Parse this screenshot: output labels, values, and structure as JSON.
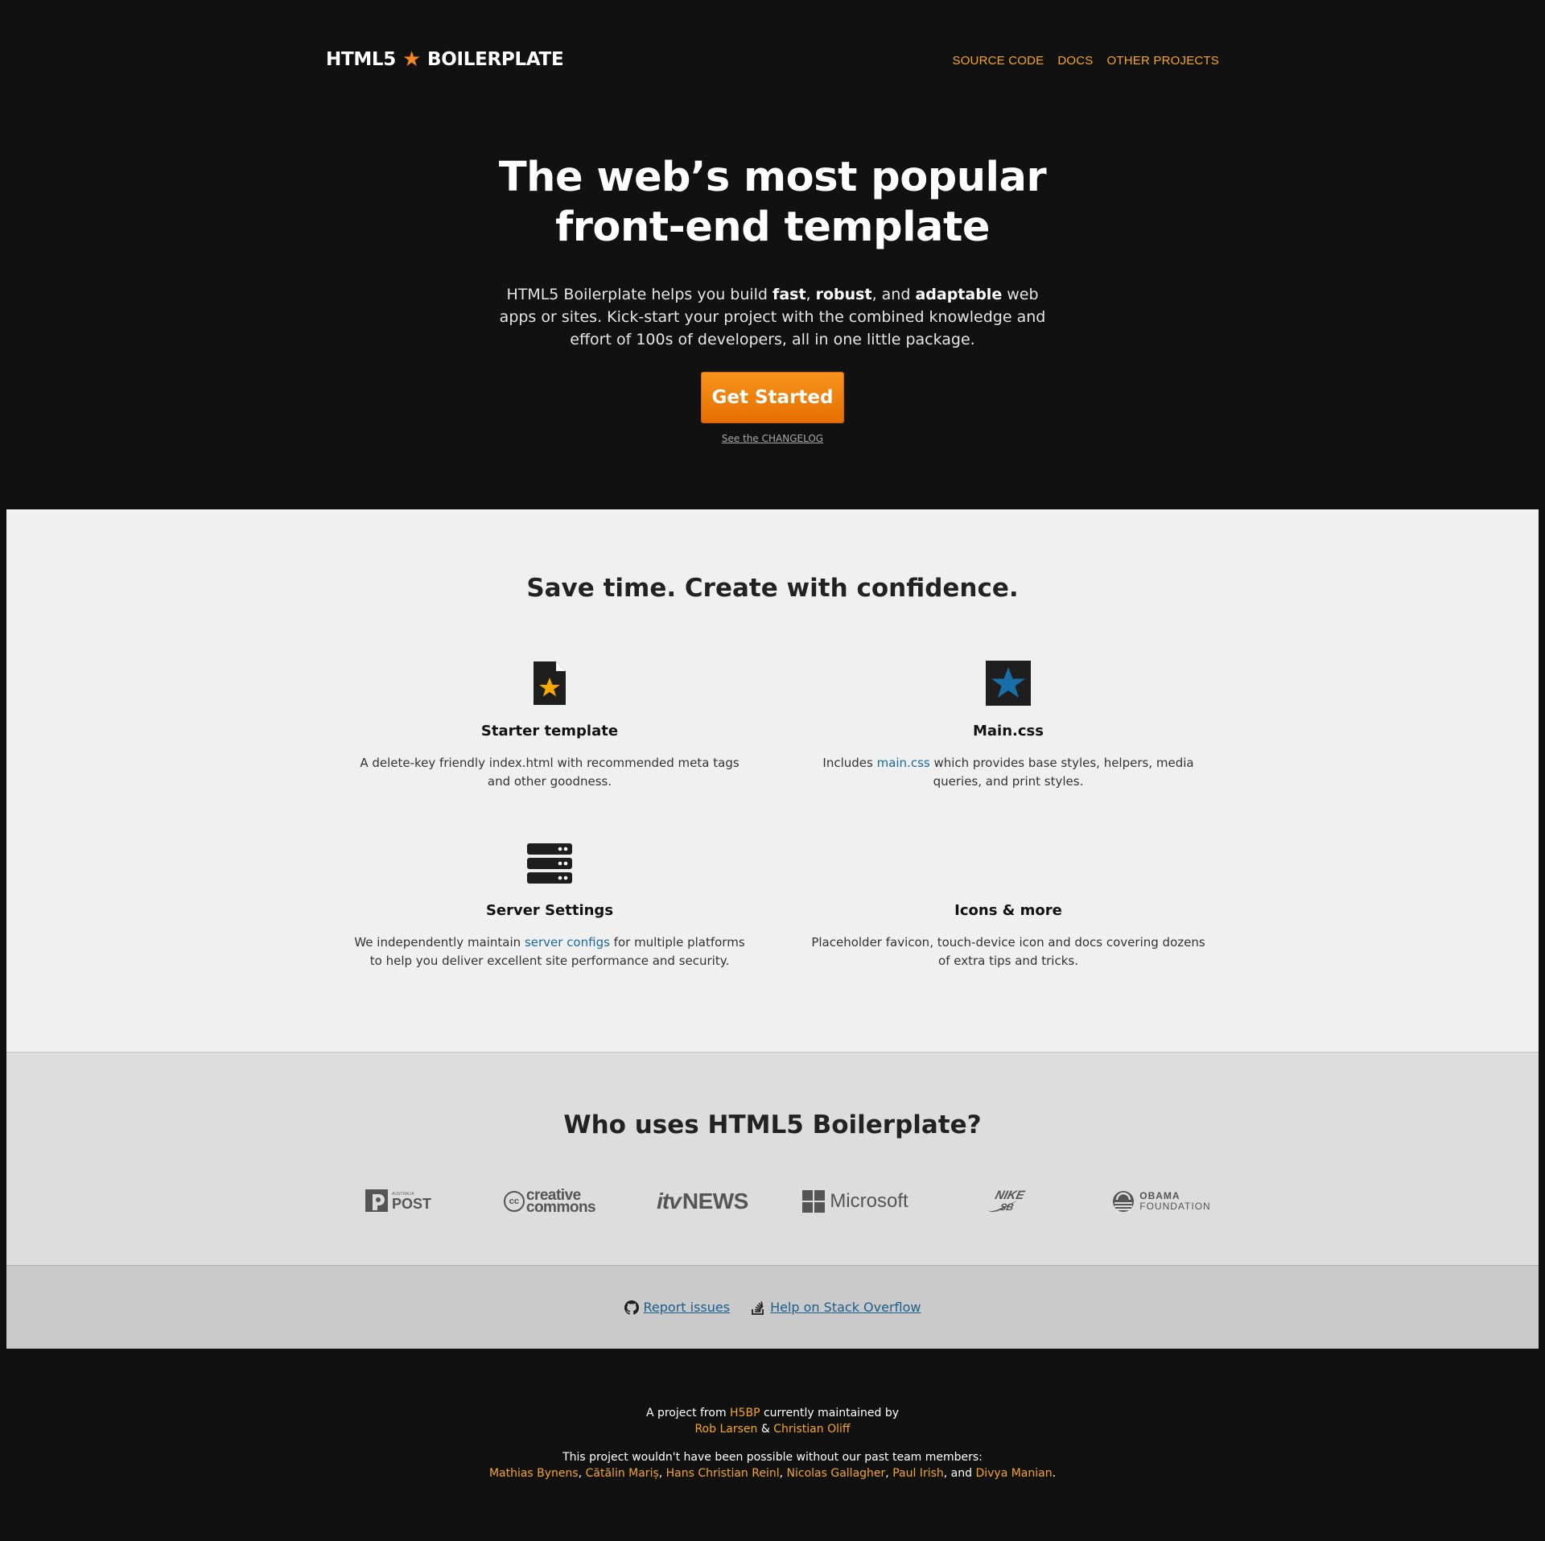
{
  "header": {
    "logo_left": "HTML5",
    "logo_right": "BOILERPLATE",
    "nav": [
      "SOURCE CODE",
      "DOCS",
      "OTHER PROJECTS"
    ]
  },
  "hero": {
    "title": "The web’s most popular front-end template",
    "lead_1": "HTML5 Boilerplate helps you build ",
    "lead_fast": "fast",
    "lead_2": ", ",
    "lead_robust": "robust",
    "lead_3": ", and ",
    "lead_adaptable": "adaptable",
    "lead_4": " web apps or sites. Kick-start your project with the combined knowledge and effort of 100s of developers, all in one little package.",
    "cta": "Get Started",
    "changelog": "See the CHANGELOG"
  },
  "features": {
    "title": "Save time. Create with confidence.",
    "items": [
      {
        "title": "Starter template",
        "text": "A delete-key friendly index.html with recommended meta tags and other goodness."
      },
      {
        "title": "Main.css",
        "text_before": "Includes ",
        "link": "main.css",
        "text_after": " which provides base styles, helpers, media queries, and print styles."
      },
      {
        "title": "Server Settings",
        "text_before": "We independently maintain ",
        "link": "server configs",
        "text_after": " for multiple platforms to help you deliver excellent site performance and security."
      },
      {
        "title": "Icons & more",
        "text": "Placeholder favicon, touch-device icon and docs covering dozens of extra tips and tricks."
      }
    ]
  },
  "users": {
    "title": "Who uses HTML5 Boilerplate?",
    "logos": [
      {
        "name": "POST",
        "small": "AUSTRALIA"
      },
      {
        "name": "creative commons",
        "line1": "creative",
        "line2": "commons",
        "badge": "cc"
      },
      {
        "name": "itv NEWS",
        "a": "itv",
        "b": "NEWS"
      },
      {
        "name": "Microsoft"
      },
      {
        "name": "NIKE SB",
        "a": "NIKE",
        "b": "SB"
      },
      {
        "name": "OBAMA FOUNDATION",
        "a": "OBAMA",
        "b": "FOUNDATION"
      }
    ]
  },
  "help": {
    "issues": "Report issues",
    "stackoverflow": "Help on Stack Overflow"
  },
  "footer": {
    "line1_a": "A project from ",
    "h5bp": "H5BP",
    "line1_b": " currently maintained by",
    "maintainer1": "Rob Larsen",
    "amp": " & ",
    "maintainer2": "Christian Oliff",
    "line3": "This project wouldn't have been possible without our past team members:",
    "past": [
      "Mathias Bynens",
      "Cătălin Mariș",
      "Hans Christian Reinl",
      "Nicolas Gallagher",
      "Paul Irish",
      "Divya Manian"
    ],
    "and": "and"
  }
}
